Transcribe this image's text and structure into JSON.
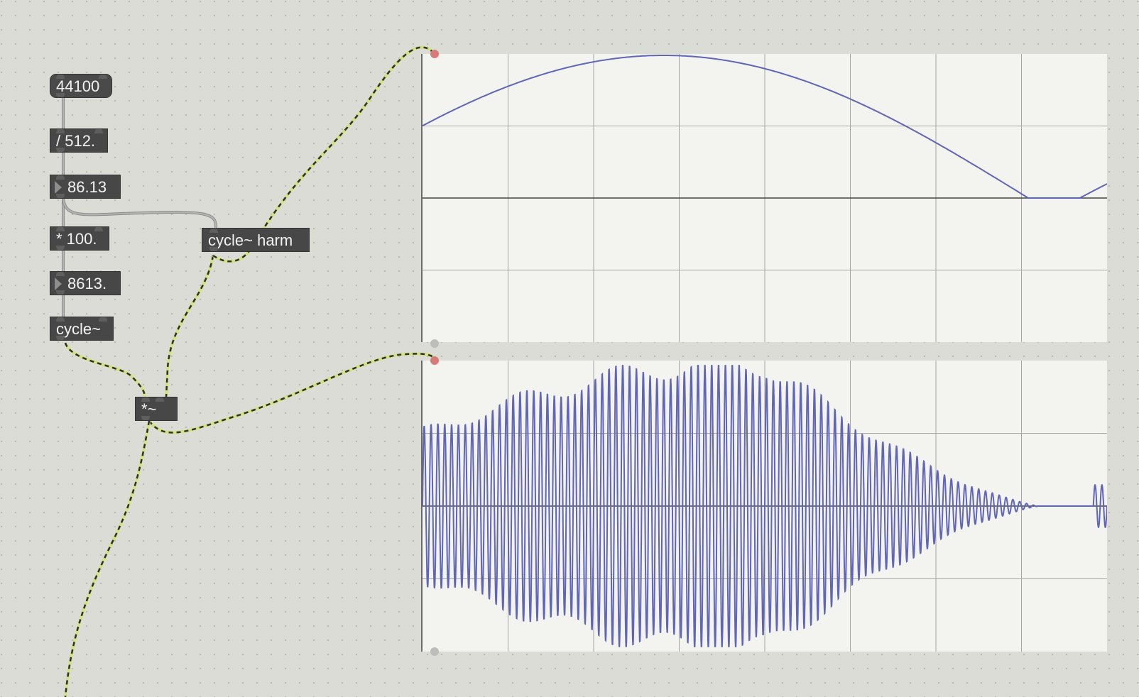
{
  "patch": {
    "objects": {
      "msg_44100": "44100",
      "div_512": "/ 512.",
      "num_86_13": "86.13",
      "mul_100": "* 100.",
      "num_8613": "8613.",
      "cycle": "cycle~",
      "cycle_harm": "cycle~ harm",
      "mul_sig": "*~"
    }
  },
  "colors": {
    "canvas_bg": "#dcdcd7",
    "object_bg": "#474747",
    "object_text": "#f2f2f2",
    "scope_bg": "#f3f3f0",
    "scope_grid": "#a0a0a0",
    "waveform": "#6065b8",
    "signal_cord": "#cfe07a",
    "control_cord": "#a0a0a0"
  },
  "scopes": [
    {
      "name": "scope-harm",
      "waveform": "half-sine window (harm buffer) rising from 0.55 to peak then falling to 0, flat, rising again",
      "amplitude_range": [
        -1,
        1
      ],
      "grid": {
        "cols": 8,
        "rows": 4
      }
    },
    {
      "name": "scope-output",
      "waveform": "8613 Hz carrier (cycle~) multiplied by harm window; envelope follows harm shape",
      "amplitude_range": [
        -1,
        1
      ],
      "grid": {
        "cols": 8,
        "rows": 4
      },
      "approx_cycles_visible": 100
    }
  ],
  "icons": {
    "number_box_triangle": "number-arrow-icon",
    "inlet": "inlet-icon",
    "outlet": "outlet-icon"
  }
}
